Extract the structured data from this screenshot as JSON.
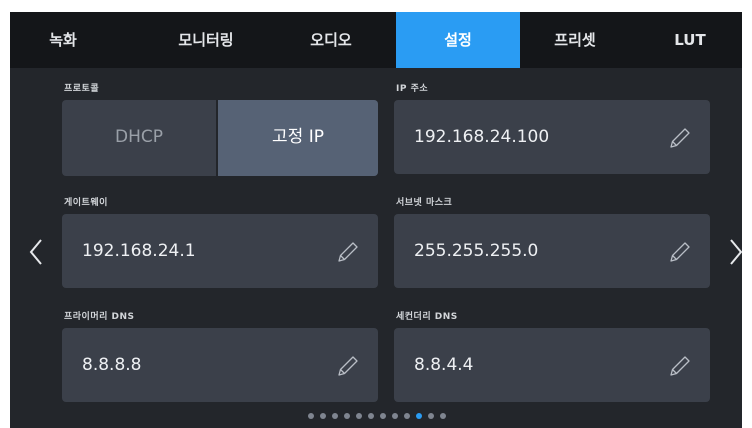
{
  "tabs": [
    {
      "label": "녹화"
    },
    {
      "label": "모니터링"
    },
    {
      "label": "오디오"
    },
    {
      "label": "설정"
    },
    {
      "label": "프리셋"
    },
    {
      "label": "LUT"
    }
  ],
  "active_tab": "설정",
  "protocol": {
    "label": "프로토콜",
    "options": [
      "DHCP",
      "고정 IP"
    ],
    "selected": "고정 IP"
  },
  "ip_address": {
    "label": "IP 주소",
    "value": "192.168.24.100"
  },
  "gateway": {
    "label": "게이트웨이",
    "value": "192.168.24.1"
  },
  "subnet_mask": {
    "label": "서브넷 마스크",
    "value": "255.255.255.0"
  },
  "primary_dns": {
    "label": "프라이머리 DNS",
    "value": "8.8.8.8"
  },
  "secondary_dns": {
    "label": "세컨더리 DNS",
    "value": "8.8.4.4"
  },
  "pagination": {
    "total": 12,
    "current": 10
  },
  "colors": {
    "accent": "#2a9cf3",
    "panel": "#3b404a",
    "background": "#23262b",
    "tabbar": "#141619"
  },
  "icons": {
    "edit": "pencil-icon",
    "prev": "chevron-left-icon",
    "next": "chevron-right-icon"
  }
}
